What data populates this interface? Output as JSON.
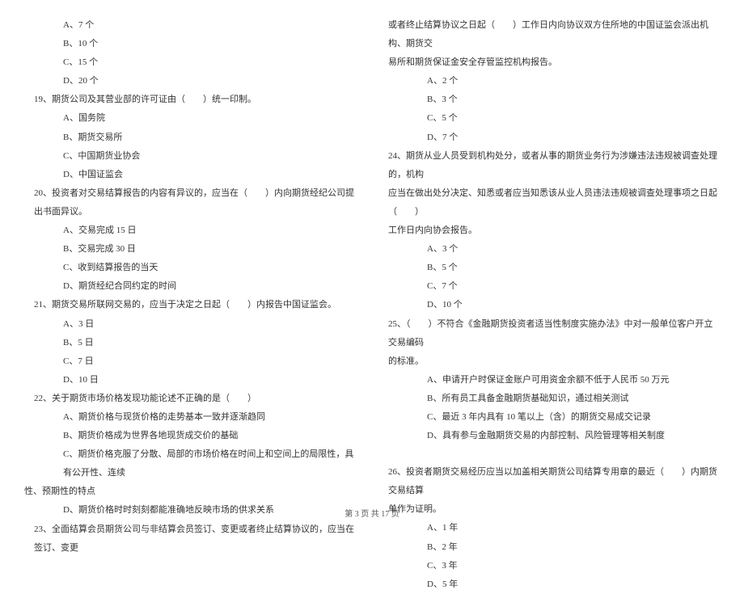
{
  "leftColumn": {
    "q18_options": {
      "a": "A、7 个",
      "b": "B、10 个",
      "c": "C、15 个",
      "d": "D、20 个"
    },
    "q19": {
      "stem": "19、期货公司及其营业部的许可证由（　　）统一印制。",
      "a": "A、国务院",
      "b": "B、期货交易所",
      "c": "C、中国期货业协会",
      "d": "D、中国证监会"
    },
    "q20": {
      "stem": "20、投资者对交易结算报告的内容有异议的，应当在（　　）内向期货经纪公司提出书面异议。",
      "a": "A、交易完成 15 日",
      "b": "B、交易完成 30 日",
      "c": "C、收到结算报告的当天",
      "d": "D、期货经纪合同约定的时间"
    },
    "q21": {
      "stem": "21、期货交易所联网交易的，应当于决定之日起（　　）内报告中国证监会。",
      "a": "A、3 日",
      "b": "B、5 日",
      "c": "C、7 日",
      "d": "D、10 日"
    },
    "q22": {
      "stem": "22、关于期货市场价格发现功能论述不正确的是（　　）",
      "a": "A、期货价格与现货价格的走势基本一致并逐渐趋同",
      "b": "B、期货价格成为世界各地现货成交价的基础",
      "c": "C、期货价格克服了分散、局部的市场价格在时间上和空间上的局限性，具有公开性、连续",
      "c_cont": "性、预期性的特点",
      "d": "D、期货价格时时刻刻都能准确地反映市场的供求关系"
    },
    "q23": {
      "stem": "23、全面结算会员期货公司与非结算会员签订、变更或者终止结算协议的，应当在签订、变更"
    }
  },
  "rightColumn": {
    "q23_cont": {
      "line1": "或者终止结算协议之日起（　　）工作日内向协议双方住所地的中国证监会派出机构、期货交",
      "line2": "易所和期货保证金安全存管监控机构报告。",
      "a": "A、2 个",
      "b": "B、3 个",
      "c": "C、5 个",
      "d": "D、7 个"
    },
    "q24": {
      "line1": "24、期货从业人员受到机构处分，或者从事的期货业务行为涉嫌违法违规被调查处理的，机构",
      "line2": "应当在做出处分决定、知悉或者应当知悉该从业人员违法违规被调查处理事项之日起（　　）",
      "line3": "工作日内向协会报告。",
      "a": "A、3 个",
      "b": "B、5 个",
      "c": "C、7 个",
      "d": "D、10 个"
    },
    "q25": {
      "line1": "25、（　　）不符合《金融期货投资者适当性制度实施办法》中对一般单位客户开立交易编码",
      "line2": "的标准。",
      "a": "A、申请开户时保证金账户可用资金余额不低于人民币 50 万元",
      "b": "B、所有员工具备金融期货基础知识，通过相关测试",
      "c": "C、最近 3 年内具有 10 笔以上（含）的期货交易成交记录",
      "d": "D、具有参与金融期货交易的内部控制、风险管理等相关制度"
    },
    "q26": {
      "line1": "26、投资者期货交易经历应当以加盖相关期货公司结算专用章的最近（　　）内期货交易结算",
      "line2": "单作为证明。",
      "a": "A、1 年",
      "b": "B、2 年",
      "c": "C、3 年",
      "d": "D、5 年"
    }
  },
  "footer": "第 3 页 共 17 页"
}
